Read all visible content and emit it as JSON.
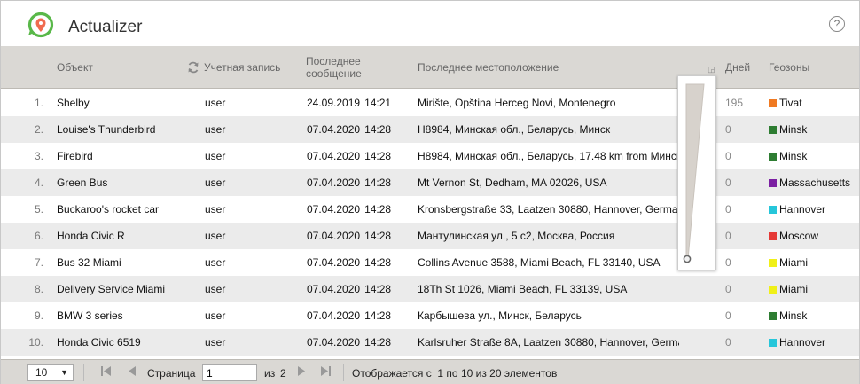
{
  "app": {
    "title": "Actualizer",
    "help_symbol": "?"
  },
  "columns": {
    "object": "Объект",
    "account": "Учетная запись",
    "message_line1": "Последнее",
    "message_line2": "сообщение",
    "location": "Последнее местоположение",
    "days": "Дней",
    "geozones": "Геозоны"
  },
  "rows": [
    {
      "num": "1.",
      "object": "Shelby",
      "account": "user",
      "date": "24.09.2019",
      "time": "14:21",
      "location": "Mirište, Opština Herceg Novi, Montenegro",
      "days": "195",
      "geo": "Tivat",
      "geo_color": "#f07a22"
    },
    {
      "num": "2.",
      "object": "Louise's Thunderbird",
      "account": "user",
      "date": "07.04.2020",
      "time": "14:28",
      "location": "H8984, Минская обл., Беларусь, Минск",
      "days": "0",
      "geo": "Minsk",
      "geo_color": "#2e7d32"
    },
    {
      "num": "3.",
      "object": "Firebird",
      "account": "user",
      "date": "07.04.2020",
      "time": "14:28",
      "location": "H8984, Минская обл., Беларусь, 17.48 km from Минск",
      "days": "0",
      "geo": "Minsk",
      "geo_color": "#2e7d32"
    },
    {
      "num": "4.",
      "object": "Green Bus",
      "account": "user",
      "date": "07.04.2020",
      "time": "14:28",
      "location": "Mt Vernon St, Dedham, MA 02026, USA",
      "days": "0",
      "geo": "Massachusetts",
      "geo_color": "#7b1fa2"
    },
    {
      "num": "5.",
      "object": "Buckaroo's rocket car",
      "account": "user",
      "date": "07.04.2020",
      "time": "14:28",
      "location": "Kronsbergstraße 33, Laatzen 30880, Hannover, Germany",
      "days": "0",
      "geo": "Hannover",
      "geo_color": "#26c6da"
    },
    {
      "num": "6.",
      "object": "Honda Civic R",
      "account": "user",
      "date": "07.04.2020",
      "time": "14:28",
      "location": "Мантулинская ул., 5 с2, Москва, Россия",
      "days": "0",
      "geo": "Moscow",
      "geo_color": "#e53935"
    },
    {
      "num": "7.",
      "object": "Bus 32 Miami",
      "account": "user",
      "date": "07.04.2020",
      "time": "14:28",
      "location": "Collins Avenue 3588, Miami Beach, FL 33140, USA",
      "days": "0",
      "geo": "Miami",
      "geo_color": "#f0f018"
    },
    {
      "num": "8.",
      "object": "Delivery Service Miami",
      "account": "user",
      "date": "07.04.2020",
      "time": "14:28",
      "location": "18Th St 1026, Miami Beach, FL 33139, USA",
      "days": "0",
      "geo": "Miami",
      "geo_color": "#f0f018"
    },
    {
      "num": "9.",
      "object": "BMW 3 series",
      "account": "user",
      "date": "07.04.2020",
      "time": "14:28",
      "location": "Карбышева ул., Минск, Беларусь",
      "days": "0",
      "geo": "Minsk",
      "geo_color": "#2e7d32"
    },
    {
      "num": "10.",
      "object": "Honda Civic 6519",
      "account": "user",
      "date": "07.04.2020",
      "time": "14:28",
      "location": "Karlsruher Straße 8A, Laatzen 30880, Hannover, Germany",
      "days": "0",
      "geo": "Hannover",
      "geo_color": "#26c6da"
    }
  ],
  "pager": {
    "page_size": "10",
    "page_label": "Страница",
    "page_value": "1",
    "of_label": "из",
    "total_pages": "2",
    "summary": "Отображается с  1 по 10 из 20 элементов"
  }
}
